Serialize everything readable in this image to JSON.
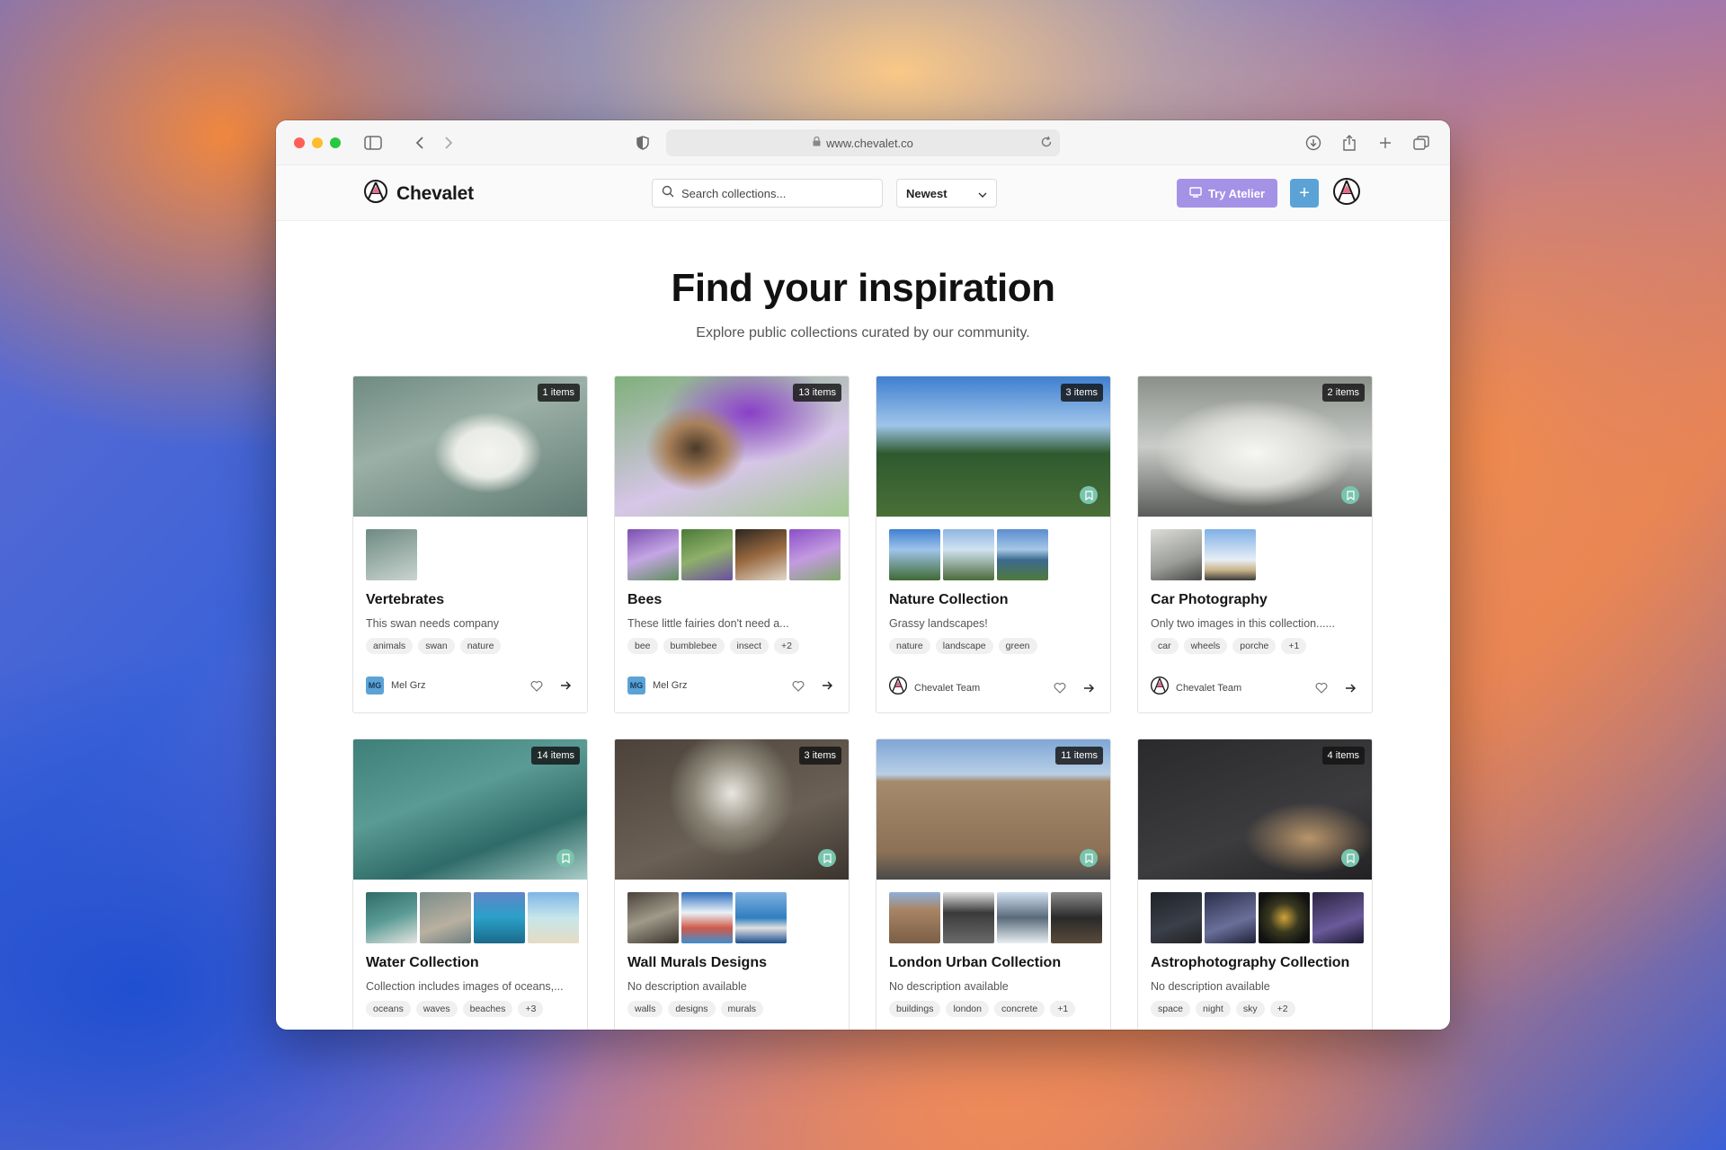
{
  "browser": {
    "url": "www.chevalet.co"
  },
  "header": {
    "brand": "Chevalet",
    "search_placeholder": "Search collections...",
    "sort_value": "Newest",
    "try_button": "Try Atelier",
    "add_button": "+"
  },
  "hero": {
    "title": "Find your inspiration",
    "subtitle": "Explore public collections curated by our community."
  },
  "collections": [
    {
      "badge": "1 items",
      "title": "Vertebrates",
      "description": "This swan needs company",
      "tags": [
        "animals",
        "swan",
        "nature"
      ],
      "author": "Mel Grz",
      "author_initials": "MG"
    },
    {
      "badge": "13 items",
      "title": "Bees",
      "description": "These little fairies don't need a...",
      "tags": [
        "bee",
        "bumblebee",
        "insect",
        "+2"
      ],
      "author": "Mel Grz",
      "author_initials": "MG"
    },
    {
      "badge": "3 items",
      "title": "Nature Collection",
      "description": "Grassy landscapes!",
      "tags": [
        "nature",
        "landscape",
        "green"
      ],
      "author": "Chevalet Team",
      "author_initials": ""
    },
    {
      "badge": "2 items",
      "title": "Car Photography",
      "description": "Only two images in this collection......",
      "tags": [
        "car",
        "wheels",
        "porche",
        "+1"
      ],
      "author": "Chevalet Team",
      "author_initials": ""
    },
    {
      "badge": "14 items",
      "title": "Water Collection",
      "description": "Collection includes images of oceans,...",
      "tags": [
        "oceans",
        "waves",
        "beaches",
        "+3"
      ],
      "author": "",
      "author_initials": ""
    },
    {
      "badge": "3 items",
      "title": "Wall Murals Designs",
      "description": "No description available",
      "tags": [
        "walls",
        "designs",
        "murals"
      ],
      "author": "",
      "author_initials": ""
    },
    {
      "badge": "11 items",
      "title": "London Urban Collection",
      "description": "No description available",
      "tags": [
        "buildings",
        "london",
        "concrete",
        "+1"
      ],
      "author": "",
      "author_initials": ""
    },
    {
      "badge": "4 items",
      "title": "Astrophotography Collection",
      "description": "No description available",
      "tags": [
        "space",
        "night",
        "sky",
        "+2"
      ],
      "author": "",
      "author_initials": ""
    }
  ],
  "colors": {
    "accent_purple": "#a492e6",
    "accent_blue": "#5ba3d6",
    "bookmark_green": "#79c4ad"
  }
}
